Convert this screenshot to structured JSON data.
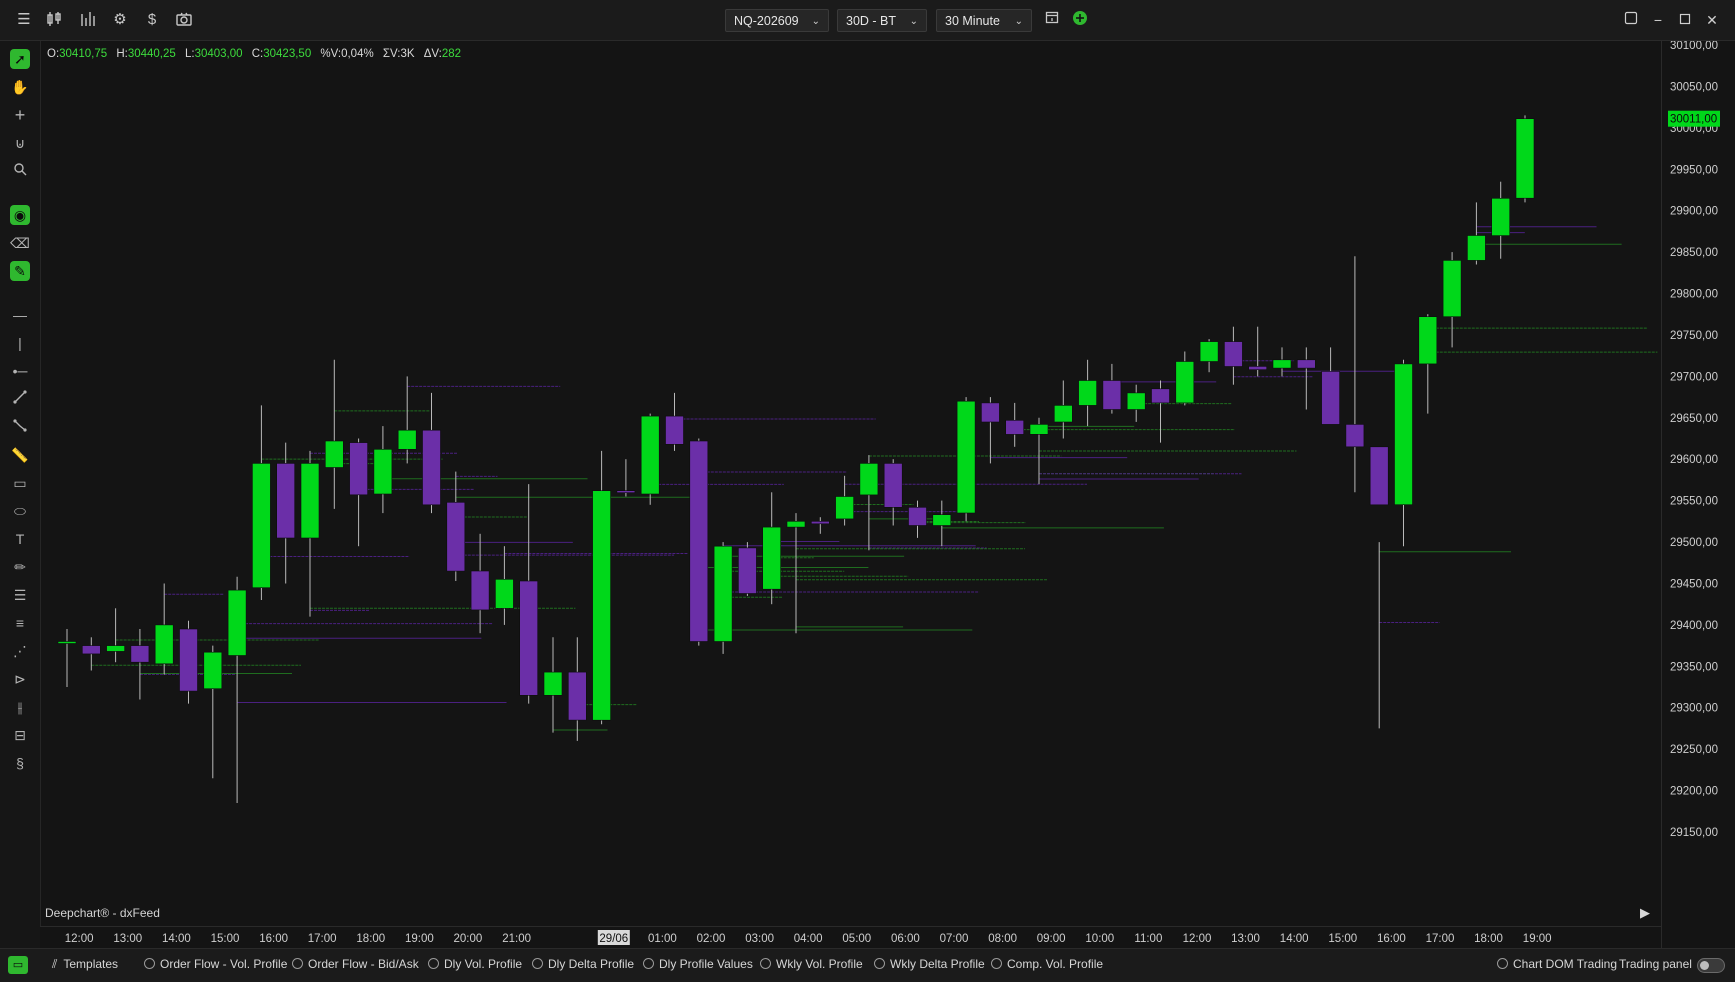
{
  "toolbar": {
    "icons": [
      "menu-icon",
      "candlestick-icon",
      "bar-chart-icon",
      "gear-icon",
      "dollar-icon",
      "camera-icon"
    ],
    "symbol": "NQ-202609",
    "range": "30D - BT",
    "interval": "30 Minute"
  },
  "ohlc": {
    "o_label": "O:",
    "o": "30410,75",
    "h_label": "H:",
    "h": "30440,25",
    "l_label": "L:",
    "l": "30403,00",
    "c_label": "C:",
    "c": "30423,50",
    "pv_label": "%V:",
    "pv": "0,04%",
    "sv_label": "ΣV:",
    "sv": "3K",
    "dv_label": "ΔV:",
    "dv": "282"
  },
  "brand": "Deepchart® - dxFeed",
  "current_price": "30011,00",
  "colors": {
    "bull": "#00d81a",
    "bear": "#6b2fa8",
    "accent": "#2fb82f",
    "wick": "#b9b9b9"
  },
  "bottom": {
    "templates": "Templates",
    "items": [
      "Order Flow - Vol. Profile",
      "Order Flow - Bid/Ask",
      "Dly Vol. Profile",
      "Dly Delta Profile",
      "Dly Profile Values",
      "Wkly Vol. Profile",
      "Wkly Delta Profile",
      "Comp. Vol. Profile"
    ],
    "chart_dom": "Chart DOM Trading",
    "trading_panel": "Trading panel"
  },
  "chart_data": {
    "type": "candlestick",
    "price_ticks": [
      "30100,00",
      "30050,00",
      "30000,00",
      "29950,00",
      "29900,00",
      "29850,00",
      "29800,00",
      "29750,00",
      "29700,00",
      "29650,00",
      "29600,00",
      "29550,00",
      "29500,00",
      "29450,00",
      "29400,00",
      "29350,00",
      "29300,00",
      "29250,00",
      "29200,00",
      "29150,00"
    ],
    "ylim": [
      29150,
      30100
    ],
    "time_labels": [
      "12:00",
      "13:00",
      "14:00",
      "15:00",
      "16:00",
      "17:00",
      "18:00",
      "19:00",
      "20:00",
      "21:00",
      "29/06",
      "01:00",
      "02:00",
      "03:00",
      "04:00",
      "05:00",
      "06:00",
      "07:00",
      "08:00",
      "09:00",
      "10:00",
      "11:00",
      "12:00",
      "13:00",
      "14:00",
      "15:00",
      "16:00",
      "17:00",
      "18:00",
      "19:00"
    ],
    "time_label_slots": [
      0.5,
      2.5,
      4.5,
      6.5,
      8.5,
      10.5,
      12.5,
      14.5,
      16.5,
      18.5,
      22.5,
      24.5,
      26.5,
      28.5,
      30.5,
      32.5,
      34.5,
      36.5,
      38.5,
      40.5,
      42.5,
      44.5,
      46.5,
      48.5,
      50.5,
      52.5,
      54.5,
      56.5,
      58.5,
      60.5
    ],
    "highlighted_label": "29/06",
    "candles": [
      {
        "o": 29378,
        "h": 29395,
        "l": 29325,
        "c": 29380
      },
      {
        "o": 29375,
        "h": 29385,
        "l": 29345,
        "c": 29365
      },
      {
        "o": 29368,
        "h": 29420,
        "l": 29355,
        "c": 29375
      },
      {
        "o": 29375,
        "h": 29395,
        "l": 29310,
        "c": 29355
      },
      {
        "o": 29353,
        "h": 29450,
        "l": 29340,
        "c": 29400
      },
      {
        "o": 29395,
        "h": 29405,
        "l": 29305,
        "c": 29320
      },
      {
        "o": 29323,
        "h": 29375,
        "l": 29215,
        "c": 29367
      },
      {
        "o": 29363,
        "h": 29458,
        "l": 29185,
        "c": 29442
      },
      {
        "o": 29445,
        "h": 29665,
        "l": 29430,
        "c": 29595
      },
      {
        "o": 29595,
        "h": 29620,
        "l": 29450,
        "c": 29505
      },
      {
        "o": 29505,
        "h": 29610,
        "l": 29410,
        "c": 29595
      },
      {
        "o": 29590,
        "h": 29720,
        "l": 29540,
        "c": 29622
      },
      {
        "o": 29620,
        "h": 29625,
        "l": 29495,
        "c": 29557
      },
      {
        "o": 29558,
        "h": 29640,
        "l": 29535,
        "c": 29612
      },
      {
        "o": 29612,
        "h": 29700,
        "l": 29595,
        "c": 29635
      },
      {
        "o": 29635,
        "h": 29680,
        "l": 29535,
        "c": 29545
      },
      {
        "o": 29548,
        "h": 29585,
        "l": 29453,
        "c": 29465
      },
      {
        "o": 29465,
        "h": 29510,
        "l": 29390,
        "c": 29418
      },
      {
        "o": 29420,
        "h": 29495,
        "l": 29400,
        "c": 29455
      },
      {
        "o": 29453,
        "h": 29570,
        "l": 29305,
        "c": 29315
      },
      {
        "o": 29315,
        "h": 29385,
        "l": 29270,
        "c": 29343
      },
      {
        "o": 29343,
        "h": 29385,
        "l": 29260,
        "c": 29285
      },
      {
        "o": 29285,
        "h": 29610,
        "l": 29280,
        "c": 29562
      },
      {
        "o": 29562,
        "h": 29600,
        "l": 29555,
        "c": 29560
      },
      {
        "o": 29558,
        "h": 29655,
        "l": 29545,
        "c": 29652
      },
      {
        "o": 29652,
        "h": 29680,
        "l": 29610,
        "c": 29618
      },
      {
        "o": 29622,
        "h": 29625,
        "l": 29375,
        "c": 29380
      },
      {
        "o": 29380,
        "h": 29500,
        "l": 29365,
        "c": 29495
      },
      {
        "o": 29493,
        "h": 29500,
        "l": 29435,
        "c": 29438
      },
      {
        "o": 29443,
        "h": 29560,
        "l": 29425,
        "c": 29518
      },
      {
        "o": 29518,
        "h": 29535,
        "l": 29390,
        "c": 29525
      },
      {
        "o": 29525,
        "h": 29530,
        "l": 29510,
        "c": 29522
      },
      {
        "o": 29528,
        "h": 29580,
        "l": 29520,
        "c": 29555
      },
      {
        "o": 29557,
        "h": 29605,
        "l": 29490,
        "c": 29595
      },
      {
        "o": 29595,
        "h": 29600,
        "l": 29520,
        "c": 29542
      },
      {
        "o": 29542,
        "h": 29550,
        "l": 29505,
        "c": 29520
      },
      {
        "o": 29520,
        "h": 29550,
        "l": 29495,
        "c": 29533
      },
      {
        "o": 29535,
        "h": 29675,
        "l": 29525,
        "c": 29670
      },
      {
        "o": 29668,
        "h": 29675,
        "l": 29595,
        "c": 29645
      },
      {
        "o": 29647,
        "h": 29668,
        "l": 29615,
        "c": 29630
      },
      {
        "o": 29630,
        "h": 29650,
        "l": 29570,
        "c": 29642
      },
      {
        "o": 29645,
        "h": 29695,
        "l": 29625,
        "c": 29665
      },
      {
        "o": 29665,
        "h": 29720,
        "l": 29640,
        "c": 29695
      },
      {
        "o": 29695,
        "h": 29715,
        "l": 29655,
        "c": 29660
      },
      {
        "o": 29660,
        "h": 29690,
        "l": 29645,
        "c": 29680
      },
      {
        "o": 29685,
        "h": 29695,
        "l": 29620,
        "c": 29668
      },
      {
        "o": 29668,
        "h": 29730,
        "l": 29665,
        "c": 29718
      },
      {
        "o": 29718,
        "h": 29745,
        "l": 29705,
        "c": 29742
      },
      {
        "o": 29742,
        "h": 29760,
        "l": 29690,
        "c": 29712
      },
      {
        "o": 29712,
        "h": 29760,
        "l": 29700,
        "c": 29708
      },
      {
        "o": 29710,
        "h": 29735,
        "l": 29700,
        "c": 29720
      },
      {
        "o": 29720,
        "h": 29735,
        "l": 29660,
        "c": 29710
      },
      {
        "o": 29706,
        "h": 29735,
        "l": 29645,
        "c": 29642
      },
      {
        "o": 29642,
        "h": 29845,
        "l": 29560,
        "c": 29615
      },
      {
        "o": 29615,
        "h": 29500,
        "l": 29275,
        "c": 29545
      },
      {
        "o": 29545,
        "h": 29720,
        "l": 29495,
        "c": 29715
      },
      {
        "o": 29715,
        "h": 29775,
        "l": 29655,
        "c": 29772
      },
      {
        "o": 29772,
        "h": 29850,
        "l": 29735,
        "c": 29840
      },
      {
        "o": 29840,
        "h": 29910,
        "l": 29835,
        "c": 29870
      },
      {
        "o": 29870,
        "h": 29935,
        "l": 29842,
        "c": 29915
      },
      {
        "o": 29915,
        "h": 30015,
        "l": 29910,
        "c": 30011
      }
    ]
  }
}
